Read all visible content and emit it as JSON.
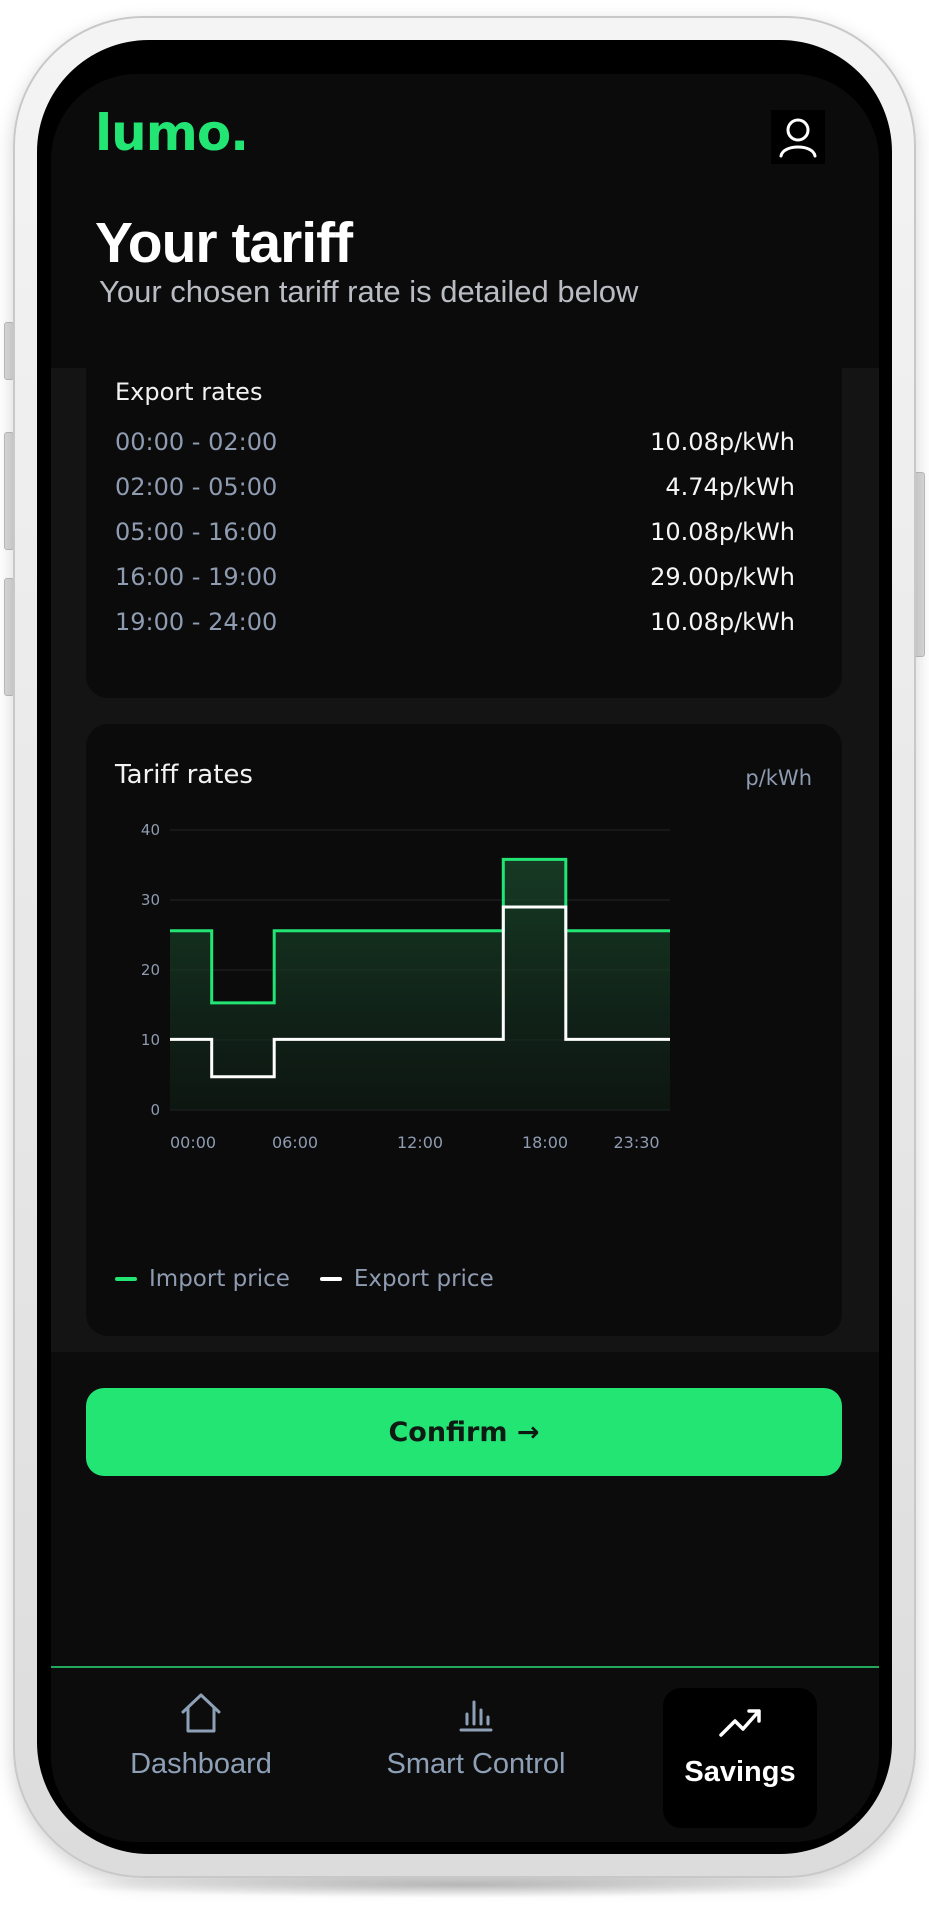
{
  "app": {
    "logo": "lumo.",
    "accent_color": "#22e574",
    "page_title": "Your tariff",
    "page_subtitle": "Your chosen tariff rate is detailed below"
  },
  "export_rates": {
    "title": "Export rates",
    "rows": [
      {
        "time": "00:00 - 02:00",
        "rate": "10.08p/kWh"
      },
      {
        "time": "02:00 - 05:00",
        "rate": "4.74p/kWh"
      },
      {
        "time": "05:00 - 16:00",
        "rate": "10.08p/kWh"
      },
      {
        "time": "16:00 - 19:00",
        "rate": "29.00p/kWh"
      },
      {
        "time": "19:00 - 24:00",
        "rate": "10.08p/kWh"
      }
    ]
  },
  "chart_card": {
    "title": "Tariff rates",
    "units": "p/kWh"
  },
  "chart_data": {
    "type": "line",
    "step": true,
    "x_ticks": [
      "00:00",
      "06:00",
      "12:00",
      "18:00",
      "23:30"
    ],
    "y_ticks": [
      0,
      10,
      20,
      30,
      40
    ],
    "xlim": [
      0,
      24
    ],
    "ylim": [
      0,
      40
    ],
    "grid": true,
    "legend_position": "bottom-left",
    "series": [
      {
        "name": "Import price",
        "color": "#22e574",
        "filled": true,
        "points": [
          [
            0,
            25.6
          ],
          [
            2,
            25.6
          ],
          [
            2,
            15.3
          ],
          [
            5,
            15.3
          ],
          [
            5,
            25.6
          ],
          [
            16,
            25.6
          ],
          [
            16,
            35.8
          ],
          [
            19,
            35.8
          ],
          [
            19,
            25.6
          ],
          [
            24,
            25.6
          ]
        ]
      },
      {
        "name": "Export price",
        "color": "#ffffff",
        "filled": false,
        "points": [
          [
            0,
            10.08
          ],
          [
            2,
            10.08
          ],
          [
            2,
            4.74
          ],
          [
            5,
            4.74
          ],
          [
            5,
            10.08
          ],
          [
            16,
            10.08
          ],
          [
            16,
            29.0
          ],
          [
            19,
            29.0
          ],
          [
            19,
            10.08
          ],
          [
            24,
            10.08
          ]
        ]
      }
    ]
  },
  "confirm_button": {
    "label": "Confirm →"
  },
  "tabbar": {
    "items": [
      {
        "label": "Dashboard",
        "icon": "home-icon",
        "active": false
      },
      {
        "label": "Smart Control",
        "icon": "bar-chart-icon",
        "active": false
      },
      {
        "label": "Savings",
        "icon": "trending-up-icon",
        "active": true
      }
    ]
  }
}
